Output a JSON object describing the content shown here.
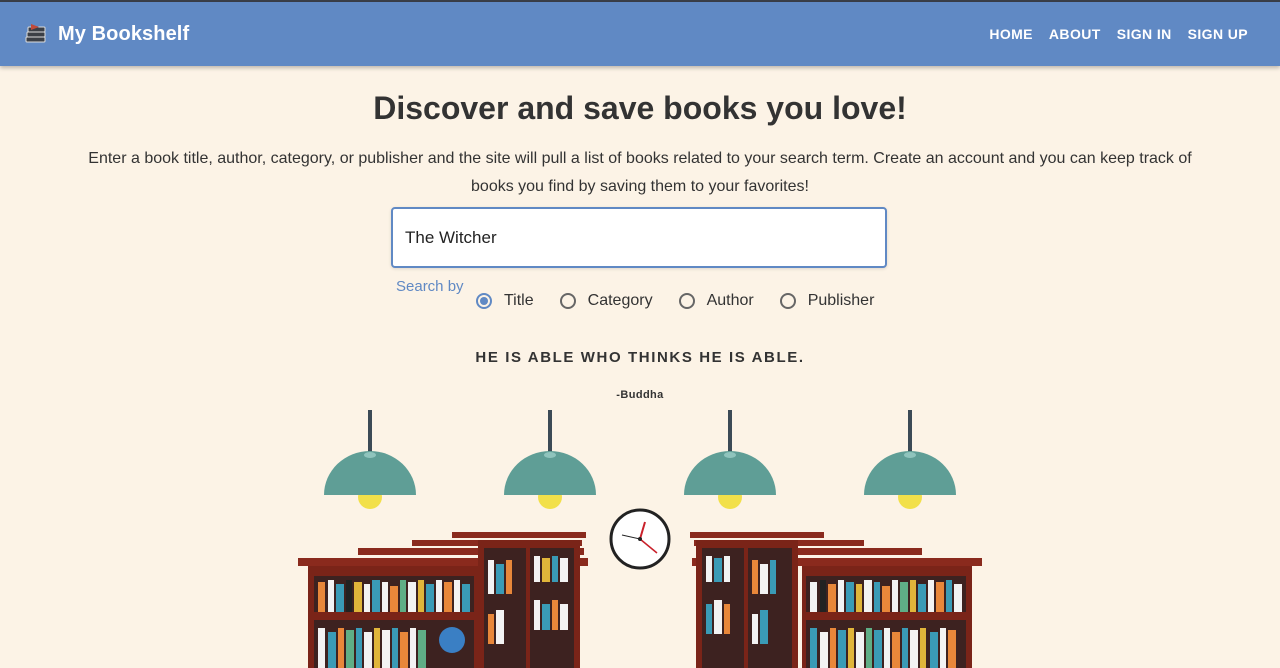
{
  "app": {
    "title": "My Bookshelf",
    "logo_icon": "books-stack-icon",
    "nav": [
      "HOME",
      "ABOUT",
      "SIGN IN",
      "SIGN UP"
    ]
  },
  "main": {
    "headline": "Discover and save books you love!",
    "intro": "Enter a book title, author, category, or publisher and the site will pull a list of books related to your search term. Create an account and you can keep track of books you find by saving them to your favorites!",
    "search": {
      "value": "The Witcher",
      "label": "Search by",
      "options": [
        "Title",
        "Category",
        "Author",
        "Publisher"
      ],
      "selected": "Title"
    },
    "quote": {
      "text": "HE IS ABLE WHO THINKS HE IS ABLE.",
      "author": "-Buddha"
    }
  },
  "colors": {
    "appbar": "#6089c4",
    "background": "#fcf3e6",
    "accent": "#6089c4",
    "lamp": "#5f9e96",
    "bulb": "#f2e04a",
    "shelf": "#8a2a1d"
  }
}
